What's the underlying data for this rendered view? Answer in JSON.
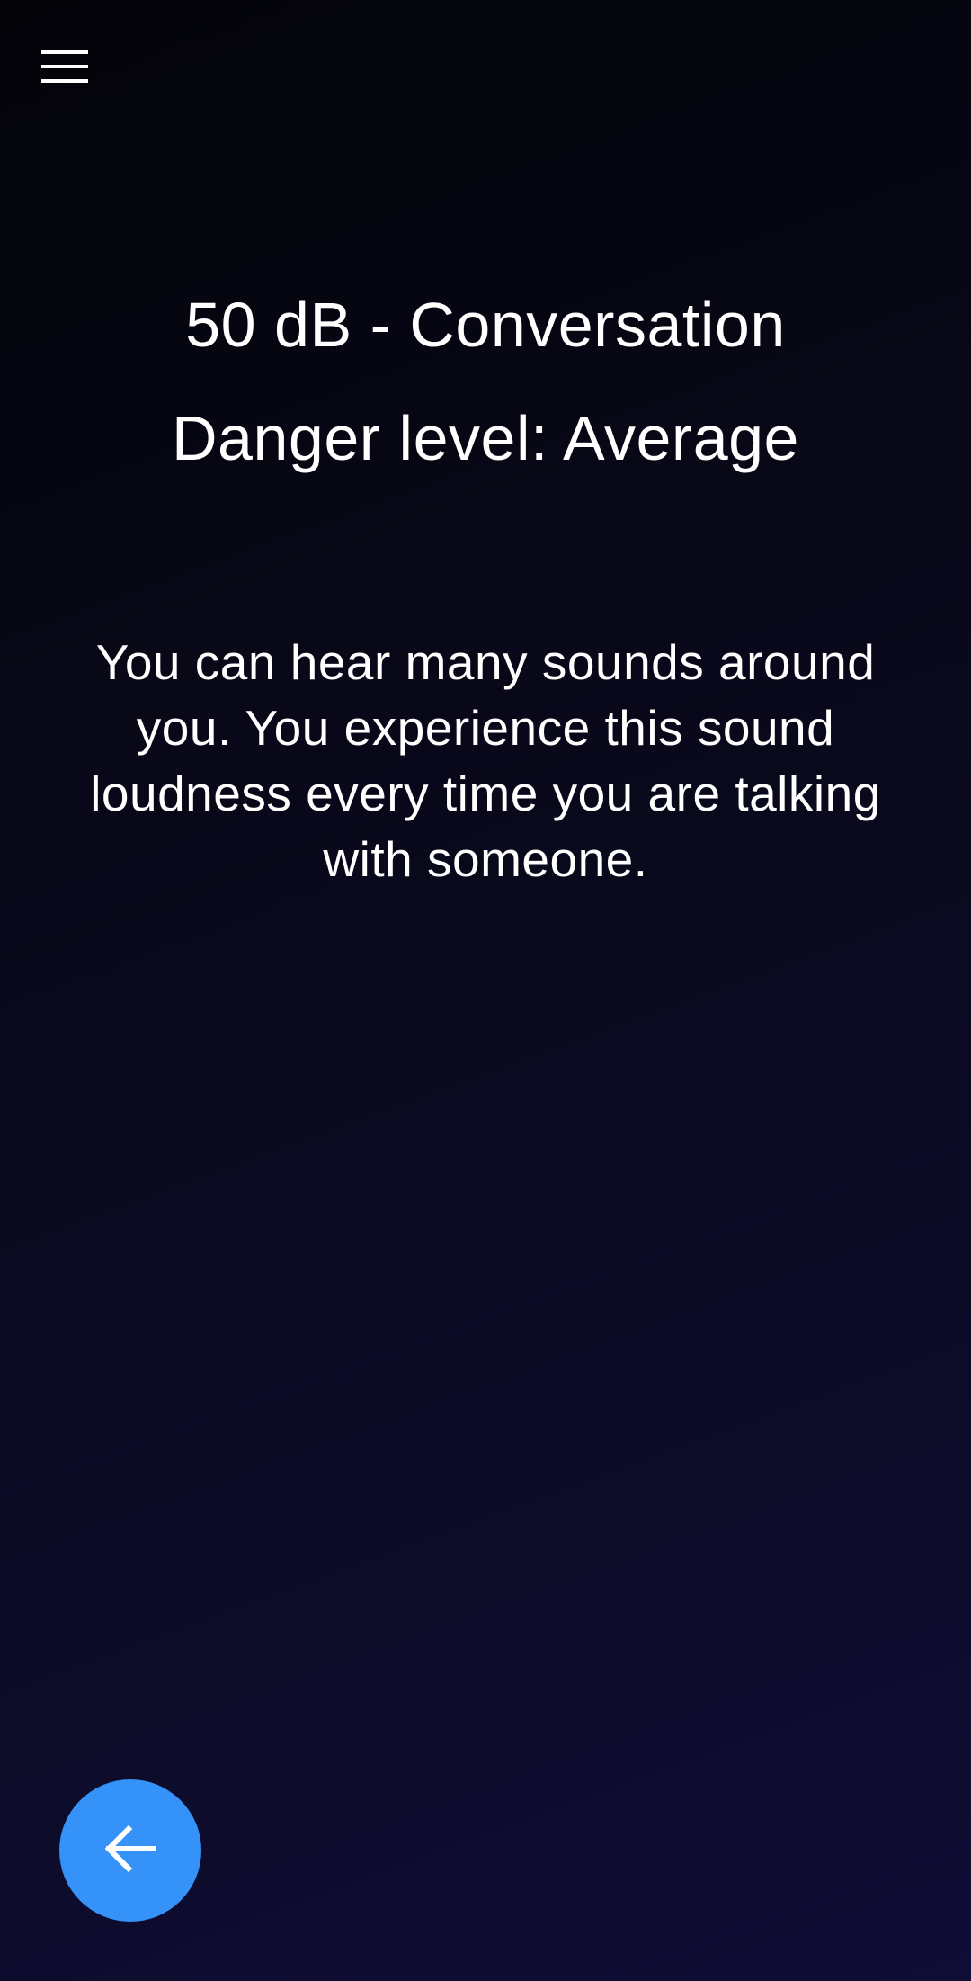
{
  "header": {
    "menu_icon": "menu-icon"
  },
  "level": {
    "title": "50 dB - Conversation",
    "danger": "Danger level: Average",
    "description": "You can hear many sounds around you. You experience this sound loudness every time you are talking with someone."
  },
  "fab": {
    "icon": "arrow-left-icon",
    "color": "#3592f8"
  },
  "colors": {
    "background_top": "#040409",
    "background_bottom": "#100d36",
    "text": "#ffffff"
  }
}
